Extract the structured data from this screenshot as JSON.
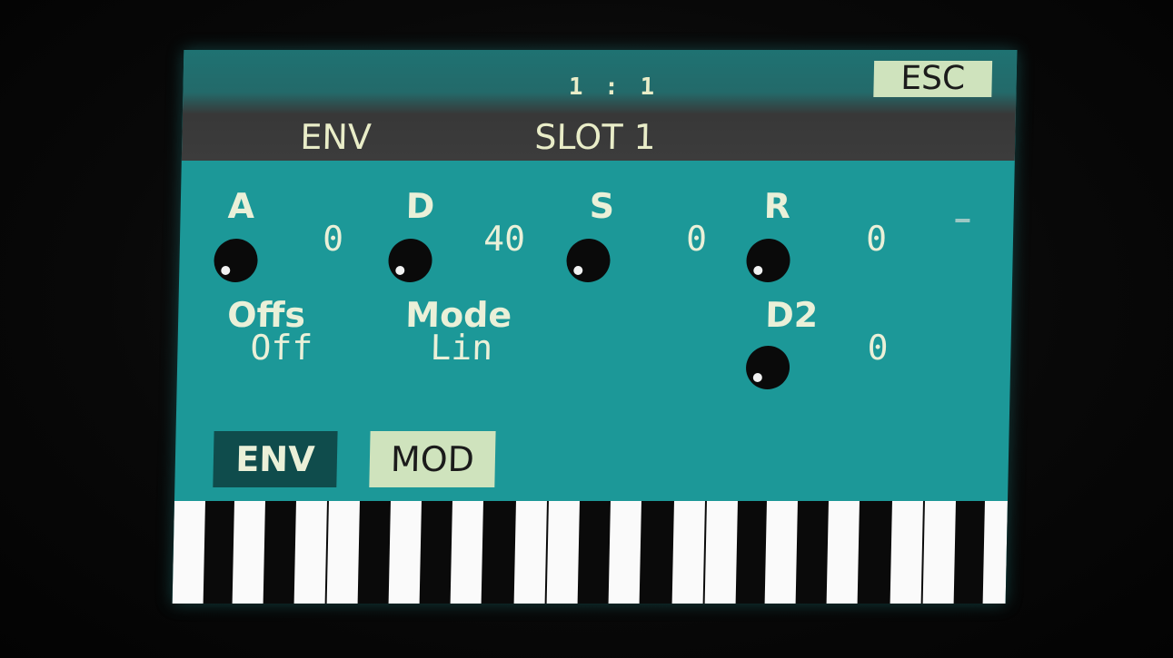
{
  "header": {
    "position": "1 :  1",
    "esc_label": "ESC",
    "left_title": "ENV",
    "slot_title": "SLOT 1"
  },
  "envelope": {
    "attack": {
      "label": "A",
      "value": "0"
    },
    "decay": {
      "label": "D",
      "value": "40"
    },
    "sustain": {
      "label": "S",
      "value": "0"
    },
    "release": {
      "label": "R",
      "value": "0"
    },
    "offset": {
      "label": "Offs",
      "value": "Off"
    },
    "mode": {
      "label": "Mode",
      "value": "Lin"
    },
    "decay2": {
      "label": "D2",
      "value": "0"
    }
  },
  "tabs": [
    {
      "label": "ENV",
      "active": true
    },
    {
      "label": "MOD",
      "active": false
    }
  ],
  "colors": {
    "screen": "#1c9898",
    "header": "#3c3c3c",
    "text": "#eaf0d8",
    "active_tab": "#0f4c4c",
    "inactive_tab": "#cfe3bd"
  },
  "icons": {
    "knob": "knob-icon"
  }
}
